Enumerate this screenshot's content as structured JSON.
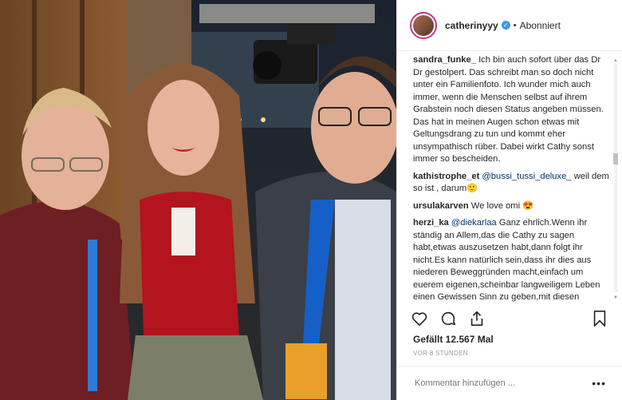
{
  "header": {
    "username": "catherinyyy",
    "verified_icon": "verified-badge-icon",
    "separator": "•",
    "follow_status": "Abonniert"
  },
  "comments": [
    {
      "user": "sandra_funke_",
      "text": "Ich bin auch sofort über das Dr Dr gestolpert. Das schreibt man so doch nicht unter ein Familienfoto. Ich wunder mich auch immer, wenn die Menschen selbst auf ihrem Grabstein noch diesen Status angeben müssen. Das hat in meinen Augen schon etwas mit Geltungsdrang zu tun und kommt eher unsympathisch rüber. Dabei wirkt Cathy sonst immer so bescheiden."
    },
    {
      "user": "kathistrophe_et",
      "mention": "@bussi_tussi_deluxe_",
      "text": " weil dem so ist , darum🙂"
    },
    {
      "user": "ursulakarven",
      "text": "We love omi 😍"
    },
    {
      "user": "herzi_ka",
      "mention": "@diekarlaa",
      "text": " Ganz ehrlich.Wenn ihr ständig an Allem,das die Cathy zu sagen habt,etwas auszusetzen habt,dann folgt ihr nicht.Es kann natürlich sein,dass ihr dies aus niederen Beweggründen macht,einfach um euerem eigenen,scheinbar langweiligem Leben einen Gewissen Sinn zu geben,mit diesen unqualifizierten Kommentaren Wenn"
    }
  ],
  "actions": {
    "like_icon": "heart-icon",
    "comment_icon": "comment-icon",
    "share_icon": "share-icon",
    "save_icon": "bookmark-icon"
  },
  "likes": "Gefällt 12.567 Mal",
  "timestamp": "VOR 8 STUNDEN",
  "add_comment": {
    "placeholder": "Kommentar hinzufügen ...",
    "more_label": "•••"
  },
  "colors": {
    "verified": "#3897f0",
    "avatar_ring": "#c13584",
    "mention": "#003569",
    "dress_red": "#b3141d",
    "lanyard_blue": "#1560c8"
  }
}
